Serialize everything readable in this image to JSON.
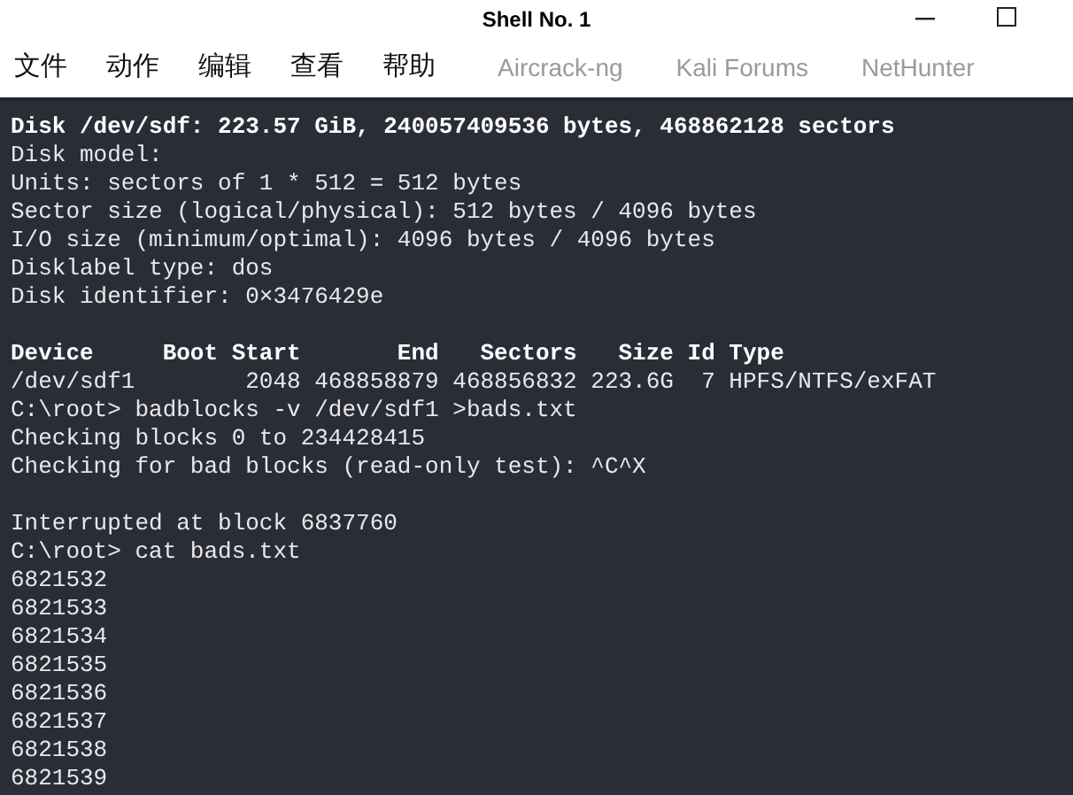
{
  "window": {
    "title": "Shell No. 1"
  },
  "menu": [
    "文件",
    "动作",
    "编辑",
    "查看",
    "帮助"
  ],
  "background_links": [
    "Aircrack-ng",
    "Kali Forums",
    "NetHunter"
  ],
  "terminal": {
    "lines": [
      {
        "kind": "bold",
        "text": "Disk /dev/sdf: 223.57 GiB, 240057409536 bytes, 468862128 sectors"
      },
      {
        "kind": "normal",
        "text": "Disk model:"
      },
      {
        "kind": "normal",
        "text": "Units: sectors of 1 * 512 = 512 bytes"
      },
      {
        "kind": "normal",
        "text": "Sector size (logical/physical): 512 bytes / 4096 bytes"
      },
      {
        "kind": "normal",
        "text": "I/O size (minimum/optimal): 4096 bytes / 4096 bytes"
      },
      {
        "kind": "normal",
        "text": "Disklabel type: dos"
      },
      {
        "kind": "normal",
        "text": "Disk identifier: 0×3476429e"
      },
      {
        "kind": "blank"
      },
      {
        "kind": "bold",
        "text": "Device     Boot Start       End   Sectors   Size Id Type"
      },
      {
        "kind": "normal",
        "text": "/dev/sdf1        2048 468858879 468856832 223.6G  7 HPFS/NTFS/exFAT"
      },
      {
        "kind": "normal",
        "text": "C:\\root> badblocks -v /dev/sdf1 >bads.txt"
      },
      {
        "kind": "normal",
        "text": "Checking blocks 0 to 234428415"
      },
      {
        "kind": "normal",
        "text": "Checking for bad blocks (read-only test): ^C^X"
      },
      {
        "kind": "blank"
      },
      {
        "kind": "normal",
        "text": "Interrupted at block 6837760"
      },
      {
        "kind": "normal",
        "text": "C:\\root> cat bads.txt"
      },
      {
        "kind": "normal",
        "text": "6821532"
      },
      {
        "kind": "normal",
        "text": "6821533"
      },
      {
        "kind": "normal",
        "text": "6821534"
      },
      {
        "kind": "normal",
        "text": "6821535"
      },
      {
        "kind": "normal",
        "text": "6821536"
      },
      {
        "kind": "normal",
        "text": "6821537"
      },
      {
        "kind": "normal",
        "text": "6821538"
      },
      {
        "kind": "normal",
        "text": "6821539"
      }
    ]
  }
}
